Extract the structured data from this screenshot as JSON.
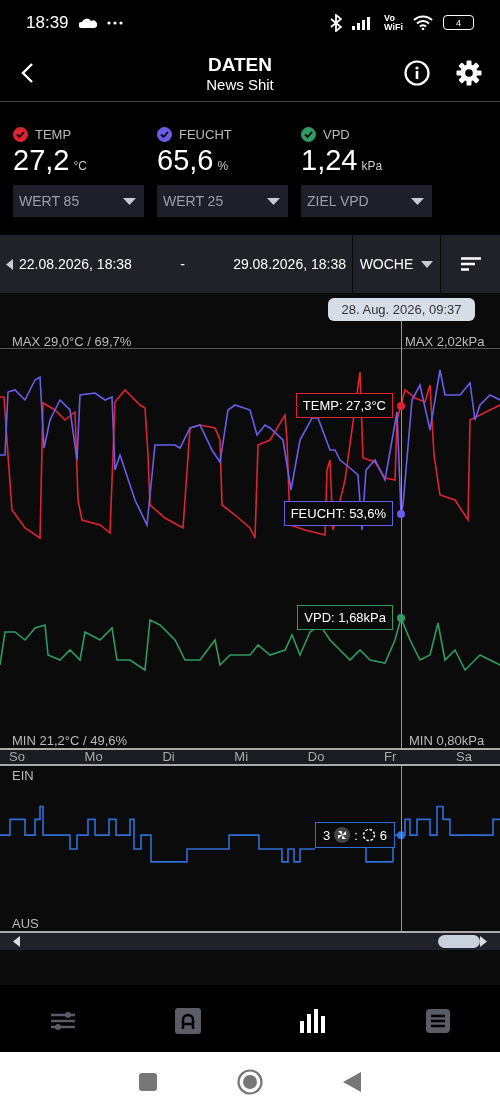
{
  "status_bar": {
    "time": "18:39",
    "network_top": "Vo",
    "network_bottom": "WiFi",
    "battery": "4"
  },
  "header": {
    "title": "DATEN",
    "subtitle": "News Shit"
  },
  "sensors": [
    {
      "label": "TEMP",
      "value": "27,2",
      "unit": "°C",
      "checked": true,
      "color": "#e0242f",
      "dropdown": "WERT 85"
    },
    {
      "label": "FEUCHT",
      "value": "65,6",
      "unit": "%",
      "checked": true,
      "color": "#6a5ee8",
      "dropdown": "WERT 25"
    },
    {
      "label": "VPD",
      "value": "1,24",
      "unit": "kPa",
      "checked": true,
      "color": "#2f9a62",
      "dropdown": "ZIEL VPD"
    }
  ],
  "range": {
    "start": "22.08.2026, 18:38",
    "separator": "-",
    "end": "29.08.2026, 18:38",
    "period": "WOCHE"
  },
  "chart": {
    "tooltip": "28. Aug. 2026, 09:37",
    "max_left": "MAX 29,0°C / 69,7%",
    "max_right": "MAX 2,02kPa",
    "min_left": "MIN 21,2°C / 49,6%",
    "min_right": "MIN 0,80kPa",
    "readouts": [
      {
        "text": "TEMP: 27,3°C",
        "color": "#e0242f"
      },
      {
        "text": "FEUCHT: 53,6%",
        "color": "#6a5ee8"
      },
      {
        "text": "VPD: 1,68kPa",
        "color": "#2f9a62"
      }
    ],
    "days": [
      "So",
      "Mo",
      "Di",
      "Mi",
      "Do",
      "Fr",
      "Sa"
    ]
  },
  "fan": {
    "top": "EIN",
    "bottom": "AUS",
    "speed": "3",
    "separator": ":",
    "value": "6"
  },
  "bottom_nav": [
    {
      "kind": "sliders",
      "selected": false
    },
    {
      "kind": "auto",
      "selected": false
    },
    {
      "kind": "bars",
      "selected": true
    },
    {
      "kind": "list",
      "selected": false
    }
  ]
}
